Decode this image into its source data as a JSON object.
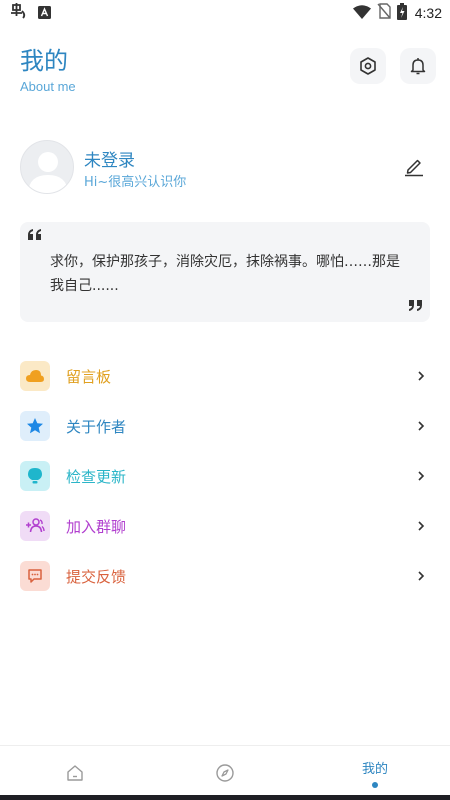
{
  "status_bar": {
    "time": "4:32",
    "icons": [
      "app-notification-icon",
      "a-badge-icon",
      "wifi-icon",
      "no-sim-icon",
      "battery-charging-icon"
    ]
  },
  "header": {
    "title": "我的",
    "subtitle": "About me",
    "buttons": [
      "settings-hexagon-icon",
      "bell-icon"
    ]
  },
  "profile": {
    "name": "未登录",
    "greeting": "Hi~很高兴认识你",
    "edit_icon": "pencil-icon"
  },
  "quote": {
    "text": "求你，保护那孩子，消除灾厄，抹除祸事。哪怕……那是我自己......"
  },
  "menu": {
    "items": [
      {
        "label": "留言板",
        "icon": "cloud-icon",
        "color": "#e0a020",
        "bg": "#fbe9c6"
      },
      {
        "label": "关于作者",
        "icon": "star-icon",
        "color": "#2e86c1",
        "bg": "#dfeefb"
      },
      {
        "label": "检查更新",
        "icon": "bulb-icon",
        "color": "#2bb5c8",
        "bg": "#c9f0f5"
      },
      {
        "label": "加入群聊",
        "icon": "add-group-icon",
        "color": "#b13fcf",
        "bg": "#f0dcf6"
      },
      {
        "label": "提交反馈",
        "icon": "feedback-icon",
        "color": "#d9623e",
        "bg": "#fbdcd4"
      }
    ]
  },
  "bottom_nav": {
    "tabs": [
      {
        "icon": "home-icon"
      },
      {
        "icon": "compass-icon"
      },
      {
        "label": "我的",
        "active": true
      }
    ]
  },
  "colors": {
    "accent": "#2e86c1",
    "card_bg": "#f4f5f7"
  }
}
